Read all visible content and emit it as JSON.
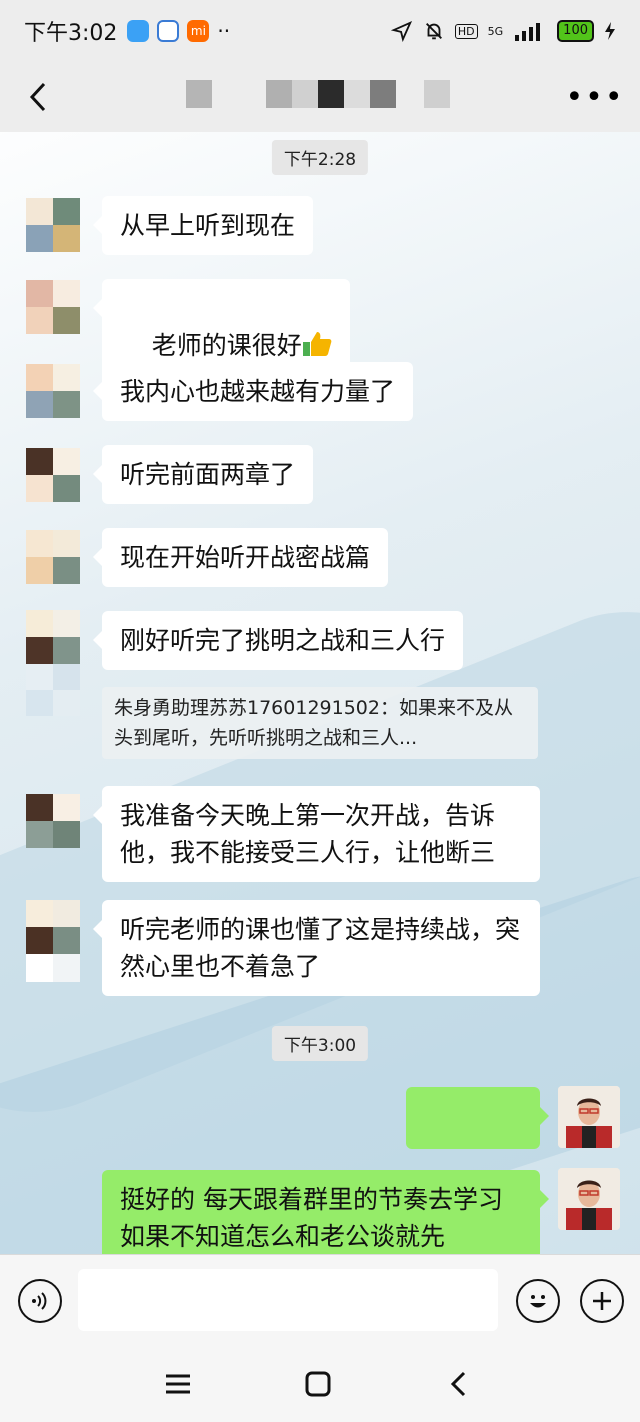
{
  "status_bar": {
    "time": "下午3:02",
    "app_mi_label": "mi",
    "network": "5G",
    "hd": "HD",
    "battery": "100"
  },
  "header": {
    "more": "•••"
  },
  "messages": {
    "ts1": "下午2:28",
    "m1": "从早上听到现在",
    "m2": "老师的课很好",
    "m3": "我内心也越来越有力量了",
    "m4": "听完前面两章了",
    "m5": "现在开始听开战密战篇",
    "m6": "刚好听完了挑明之战和三人行",
    "quote": "朱身勇助理苏苏17601291502：如果来不及从头到尾听，先听听挑明之战和三人...",
    "m7": "我准备今天晚上第一次开战，告诉他，我不能接受三人行，让他断三",
    "m8": "听完老师的课也懂了这是持续战，突然心里也不着急了",
    "ts2": "下午3:00",
    "m10": "挺好的 每天跟着群里的节奏去学习 如果不知道怎么和老公谈就先"
  },
  "colors": {
    "my_bubble": "#95ec69",
    "their_bubble": "#ffffff",
    "thumbs": "#f5b400"
  },
  "icons": [
    "back-icon",
    "more-icon",
    "voice-icon",
    "emoji-icon",
    "plus-icon",
    "thumbs-up-icon",
    "menu-icon",
    "home-icon",
    "nav-back-icon"
  ]
}
